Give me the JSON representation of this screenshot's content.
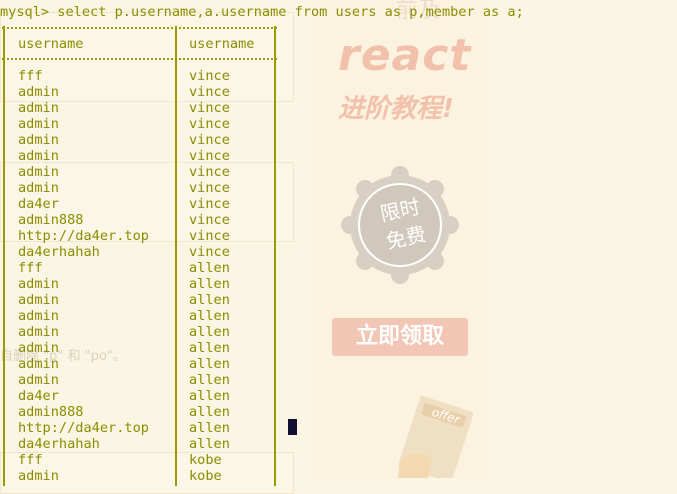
{
  "background": {
    "ad_top_text": "前及",
    "ad_title": "react",
    "ad_subtitle": "进阶教程!",
    "ad_seal_line1": "限时",
    "ad_seal_line2": "免费",
    "ad_button": "立即领取",
    "ad_book_label": "offer",
    "page_snippet": "自删除 \"p\" 和 \"po\"。"
  },
  "terminal": {
    "prompt": "mysql> select p.username,a.username from users as p,member as a;",
    "columns": [
      "username",
      "username"
    ],
    "rows": [
      [
        "fff",
        "vince"
      ],
      [
        "admin",
        "vince"
      ],
      [
        "admin",
        "vince"
      ],
      [
        "admin",
        "vince"
      ],
      [
        "admin",
        "vince"
      ],
      [
        "admin",
        "vince"
      ],
      [
        "admin",
        "vince"
      ],
      [
        "admin",
        "vince"
      ],
      [
        "da4er",
        "vince"
      ],
      [
        "admin888",
        "vince"
      ],
      [
        "http://da4er.top",
        "vince"
      ],
      [
        "da4erhahah",
        "vince"
      ],
      [
        "fff",
        "allen"
      ],
      [
        "admin",
        "allen"
      ],
      [
        "admin",
        "allen"
      ],
      [
        "admin",
        "allen"
      ],
      [
        "admin",
        "allen"
      ],
      [
        "admin",
        "allen"
      ],
      [
        "admin",
        "allen"
      ],
      [
        "admin",
        "allen"
      ],
      [
        "da4er",
        "allen"
      ],
      [
        "admin888",
        "allen"
      ],
      [
        "http://da4er.top",
        "allen"
      ],
      [
        "da4erhahah",
        "allen"
      ],
      [
        "fff",
        "kobe"
      ],
      [
        "admin",
        "kobe"
      ]
    ],
    "colors": {
      "text": "#8b8d00",
      "background": "#fbf5e3",
      "cursor": "#101030"
    }
  }
}
